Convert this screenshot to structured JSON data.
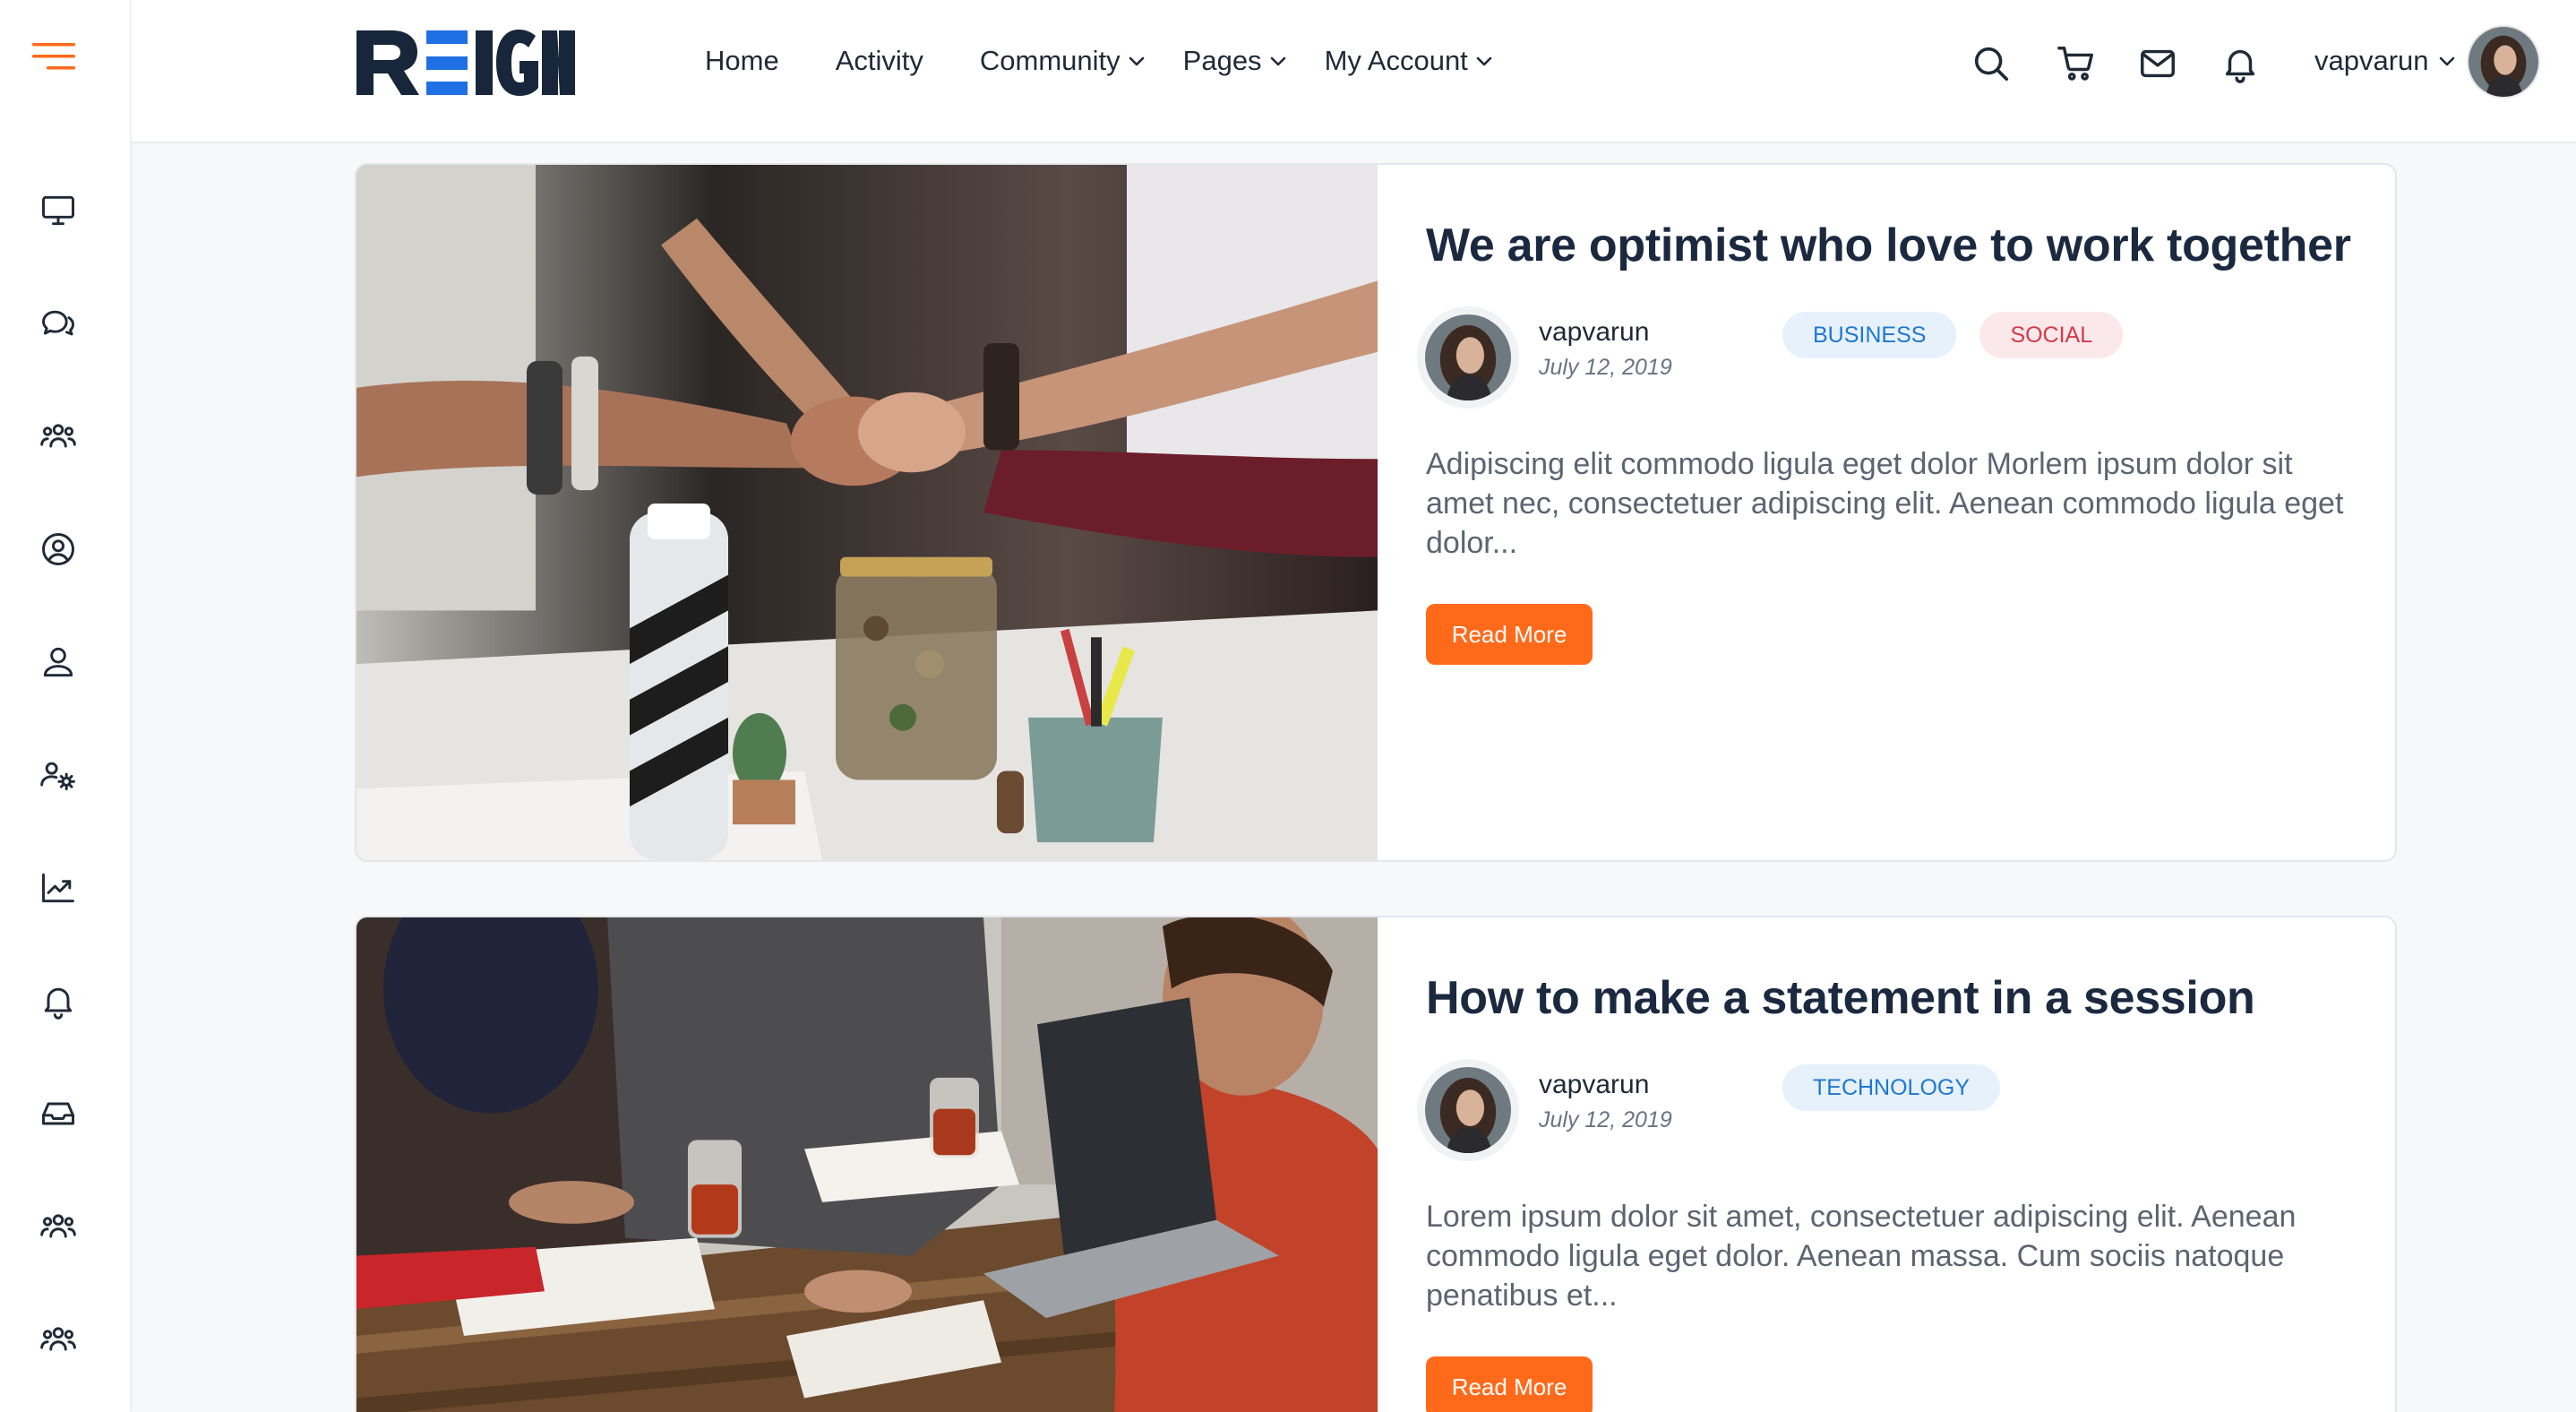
{
  "brand": {
    "logo_text": "REIGN",
    "accent": "#ff6a1a",
    "logo_blue": "#1f6fe5"
  },
  "nav": {
    "items": [
      {
        "label": "Home",
        "has_dropdown": false
      },
      {
        "label": "Activity",
        "has_dropdown": false
      },
      {
        "label": "Community",
        "has_dropdown": true
      },
      {
        "label": "Pages",
        "has_dropdown": true
      },
      {
        "label": "My Account",
        "has_dropdown": true
      }
    ]
  },
  "header": {
    "icons": [
      "search-icon",
      "cart-icon",
      "mail-icon",
      "bell-icon"
    ],
    "user_name": "vapvarun"
  },
  "sidebar": {
    "icons": [
      "menu-icon",
      "monitor-icon",
      "chat-bubbles-icon",
      "groups-icon",
      "user-circle-icon",
      "user-icon",
      "user-settings-icon",
      "chart-line-icon",
      "bell-icon",
      "inbox-icon",
      "groups-icon",
      "groups-icon"
    ]
  },
  "posts": [
    {
      "title": "We are optimist who love to work together",
      "author": "vapvarun",
      "date": "July 12, 2019",
      "tags": [
        {
          "label": "BUSINESS",
          "color": "blue"
        },
        {
          "label": "SOCIAL",
          "color": "red"
        }
      ],
      "excerpt": "Adipiscing elit commodo ligula eget dolor Morlem ipsum dolor sit amet nec, consectetuer adipiscing elit. Aenean commodo ligula eget dolor...",
      "button": "Read More"
    },
    {
      "title": "How to make a statement in a session",
      "author": "vapvarun",
      "date": "July 12, 2019",
      "tags": [
        {
          "label": "TECHNOLOGY",
          "color": "blue"
        }
      ],
      "excerpt": "Lorem ipsum dolor sit amet, consectetuer adipiscing elit. Aenean commodo ligula eget dolor. Aenean massa. Cum sociis natoque penatibus et...",
      "button": "Read More"
    }
  ]
}
